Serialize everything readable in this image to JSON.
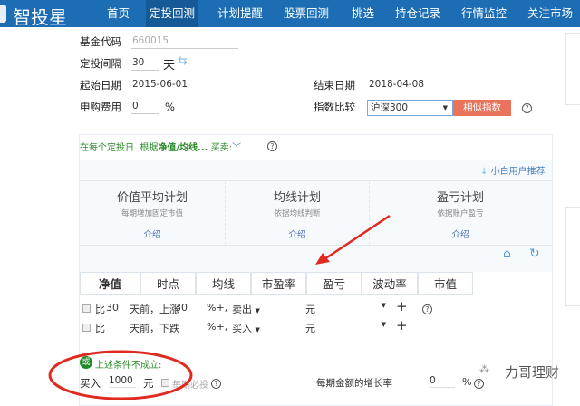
{
  "app": {
    "logo": "智投星"
  },
  "nav": [
    "首页",
    "定投回测",
    "计划提醒",
    "股票回测",
    "挑选",
    "持仓记录",
    "行情监控",
    "关注市场"
  ],
  "form": {
    "fund_code_label": "基金代码",
    "fund_code_placeholder": "660015",
    "interval_label": "定投间隔",
    "interval_value": "30",
    "interval_unit": "天",
    "start_label": "起始日期",
    "start_value": "2015-06-01",
    "end_label": "结束日期",
    "end_value": "2018-04-08",
    "fee_label": "申购费用",
    "fee_value": "0",
    "fee_unit": "%",
    "index_label": "指数比较",
    "index_value": "沪深300",
    "similar_button": "相似指数"
  },
  "strategy": {
    "prefix": "在每个定投日",
    "basis": "根据",
    "basis_bold": "净值/均线...",
    "trade": "买卖:",
    "recommend": "小白用户推荐"
  },
  "plans": [
    {
      "title": "价值平均计划",
      "sub": "每期增加固定市值",
      "link": "介绍"
    },
    {
      "title": "均线计划",
      "sub": "依据均线判断",
      "link": "介绍"
    },
    {
      "title": "盈亏计划",
      "sub": "依据账户盈亏",
      "link": "介绍"
    }
  ],
  "tabs": [
    "净值",
    "时点",
    "均线",
    "市盈率",
    "盈亏",
    "波动率",
    "市值"
  ],
  "rules": [
    {
      "bi": "比",
      "days": "30",
      "mid": "天前，上涨",
      "pct": "30",
      "suffix": "%+,",
      "action": "卖出",
      "amount": "",
      "unit": "元"
    },
    {
      "bi": "比",
      "days": "",
      "mid": "天前，下跌",
      "pct": "",
      "suffix": "%+,",
      "action": "买入",
      "amount": "",
      "unit": "元"
    }
  ],
  "fallback": {
    "badge": "或",
    "text": "上述条件不成立:",
    "buy_label": "买入",
    "buy_value": "1000",
    "buy_unit": "元",
    "each_label": "每期必投",
    "growth_label": "每期金额的增长率",
    "growth_value": "0",
    "growth_unit": "%"
  },
  "watermark": "力哥理财"
}
